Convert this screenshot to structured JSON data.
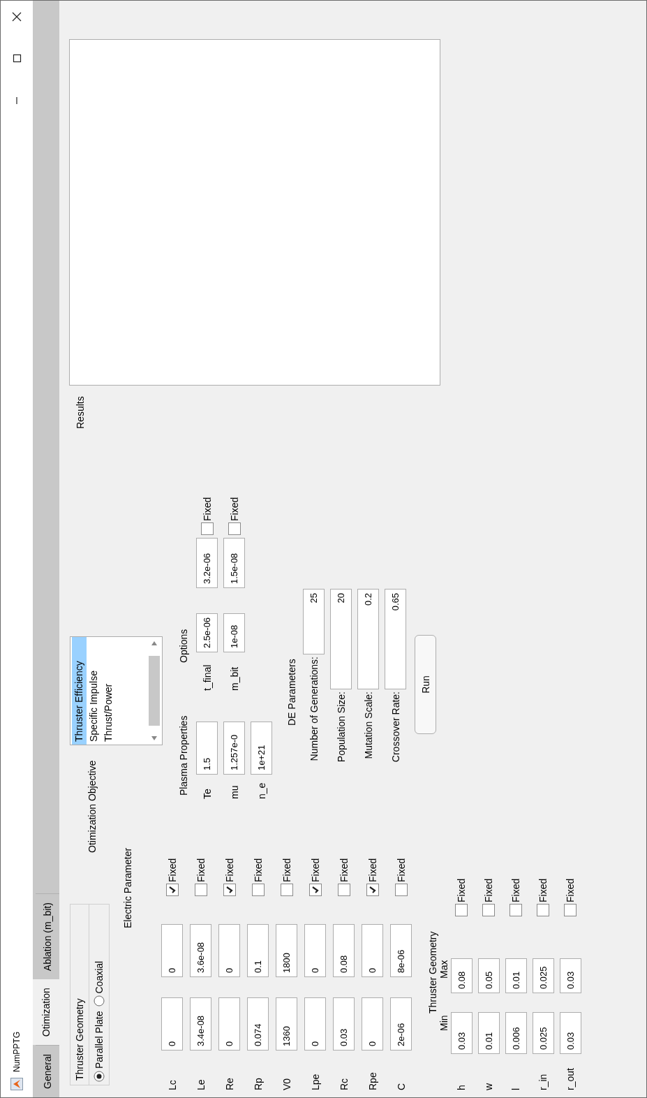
{
  "window": {
    "title": "NumPPTG"
  },
  "tabs": [
    {
      "label": "General",
      "selected": false
    },
    {
      "label": "Otimization",
      "selected": true
    },
    {
      "label": "Ablation (m_bit)",
      "selected": false
    }
  ],
  "thruster_geometry_group": {
    "title": "Thruster Geometry",
    "options": [
      {
        "label": "Parallel Plate",
        "selected": true
      },
      {
        "label": "Coaxial",
        "selected": false
      }
    ]
  },
  "electric_parameter": {
    "title": "Electric Parameter",
    "rows": [
      {
        "label": "Lc",
        "value_1": "0",
        "value_2": "0",
        "fixed": true,
        "checkbox_label": "Fixed"
      },
      {
        "label": "Le",
        "value_1": "3.4e-08",
        "value_2": "3.6e-08",
        "fixed": false,
        "checkbox_label": "Fixed"
      },
      {
        "label": "Re",
        "value_1": "0",
        "value_2": "0",
        "fixed": true,
        "checkbox_label": "Fixed"
      },
      {
        "label": "Rp",
        "value_1": "0.074",
        "value_2": "0.1",
        "fixed": false,
        "checkbox_label": "Fixed"
      },
      {
        "label": "V0",
        "value_1": "1360",
        "value_2": "1800",
        "fixed": false,
        "checkbox_label": "Fixed"
      },
      {
        "label": "Lpe",
        "value_1": "0",
        "value_2": "0",
        "fixed": true,
        "checkbox_label": "Fixed"
      },
      {
        "label": "Rc",
        "value_1": "0.03",
        "value_2": "0.08",
        "fixed": false,
        "checkbox_label": "Fixed"
      },
      {
        "label": "Rpe",
        "value_1": "0",
        "value_2": "0",
        "fixed": true,
        "checkbox_label": "Fixed"
      },
      {
        "label": "C",
        "value_1": "2e-06",
        "value_2": "8e-06",
        "fixed": false,
        "checkbox_label": "Fixed"
      }
    ]
  },
  "thruster_geometry": {
    "title": "Thruster Geometry",
    "min_header": "Min",
    "max_header": "Max",
    "rows": [
      {
        "label": "h",
        "min": "0.03",
        "max": "0.08",
        "fixed": false,
        "checkbox_label": "Fixed"
      },
      {
        "label": "w",
        "min": "0.01",
        "max": "0.05",
        "fixed": false,
        "checkbox_label": "Fixed"
      },
      {
        "label": "l",
        "min": "0.006",
        "max": "0.01",
        "fixed": false,
        "checkbox_label": "Fixed"
      },
      {
        "label": "r_in",
        "min": "0.025",
        "max": "0.025",
        "fixed": false,
        "checkbox_label": "Fixed"
      },
      {
        "label": "r_out",
        "min": "0.03",
        "max": "0.03",
        "fixed": false,
        "checkbox_label": "Fixed"
      }
    ]
  },
  "optimization_objective": {
    "title": "Otimization Objective",
    "items": [
      {
        "label": "Thruster Efficiency",
        "selected": true
      },
      {
        "label": "Specific Impulse",
        "selected": false
      },
      {
        "label": "Thrust/Power",
        "selected": false
      }
    ]
  },
  "plasma_properties": {
    "title": "Plasma Properties",
    "rows": [
      {
        "label": "Te",
        "value": "1.5"
      },
      {
        "label": "mu",
        "value": "1.257e-0"
      },
      {
        "label": "n_e",
        "value": "1e+21"
      }
    ]
  },
  "options": {
    "title": "Options",
    "rows": [
      {
        "label": "t_final",
        "value_1": "2.5e-06",
        "value_2": "3.2e-06",
        "fixed": false,
        "checkbox_label": "Fixed"
      },
      {
        "label": "m_bit",
        "value_1": "1e-08",
        "value_2": "1.5e-08",
        "fixed": false,
        "checkbox_label": "Fixed"
      }
    ]
  },
  "de_parameters": {
    "title": "DE Parameters",
    "rows": [
      {
        "label": "Number of Generations:",
        "value": "25",
        "kind": "short"
      },
      {
        "label": "Population Size:",
        "value": "20",
        "kind": "long"
      },
      {
        "label": "Mutation Scale:",
        "value": "0.2",
        "kind": "long"
      },
      {
        "label": "Crossover Rate:",
        "value": "0.65",
        "kind": "long"
      }
    ]
  },
  "run_button": "Run",
  "results": {
    "title": "Results"
  }
}
